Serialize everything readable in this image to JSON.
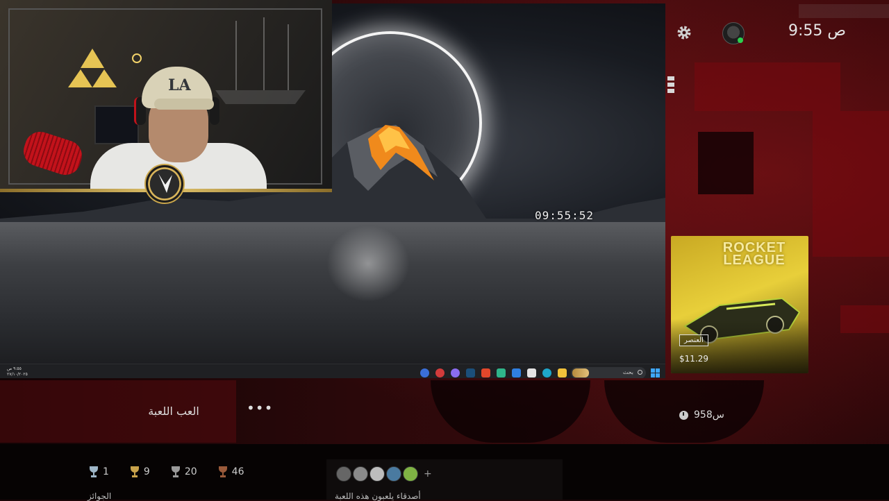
{
  "status": {
    "time": "9:55 ص"
  },
  "game": {
    "card_logo": "ROCKET LEAGUE",
    "tag": "العنصر",
    "price": "$11.29",
    "playtime": "958س",
    "play_label": "العب اللعبة",
    "more_label": "•••"
  },
  "trophies": {
    "items": [
      {
        "type": "platinum",
        "count": "1",
        "color": "#9fb7c9"
      },
      {
        "type": "gold",
        "count": "9",
        "color": "#c9a34b"
      },
      {
        "type": "silver",
        "count": "20",
        "color": "#9a9a9a"
      },
      {
        "type": "bronze",
        "count": "46",
        "color": "#9a5a3a"
      }
    ],
    "label": "الجوائز"
  },
  "friends": {
    "label": "أصدقاء يلعبون هذه اللعبة",
    "more": "+"
  },
  "desktop": {
    "clock": "09:55:52",
    "taskbar_time": "٩:٥٥ ص",
    "taskbar_date": "٢٧/١٠/٢٠٢٥",
    "search_placeholder": "بحث"
  },
  "webcam": {
    "cap_text": "LA"
  },
  "colors": {
    "background_red": "#3b0b0d",
    "online": "#2bd14f",
    "accent_gold": "#d8b45a"
  }
}
